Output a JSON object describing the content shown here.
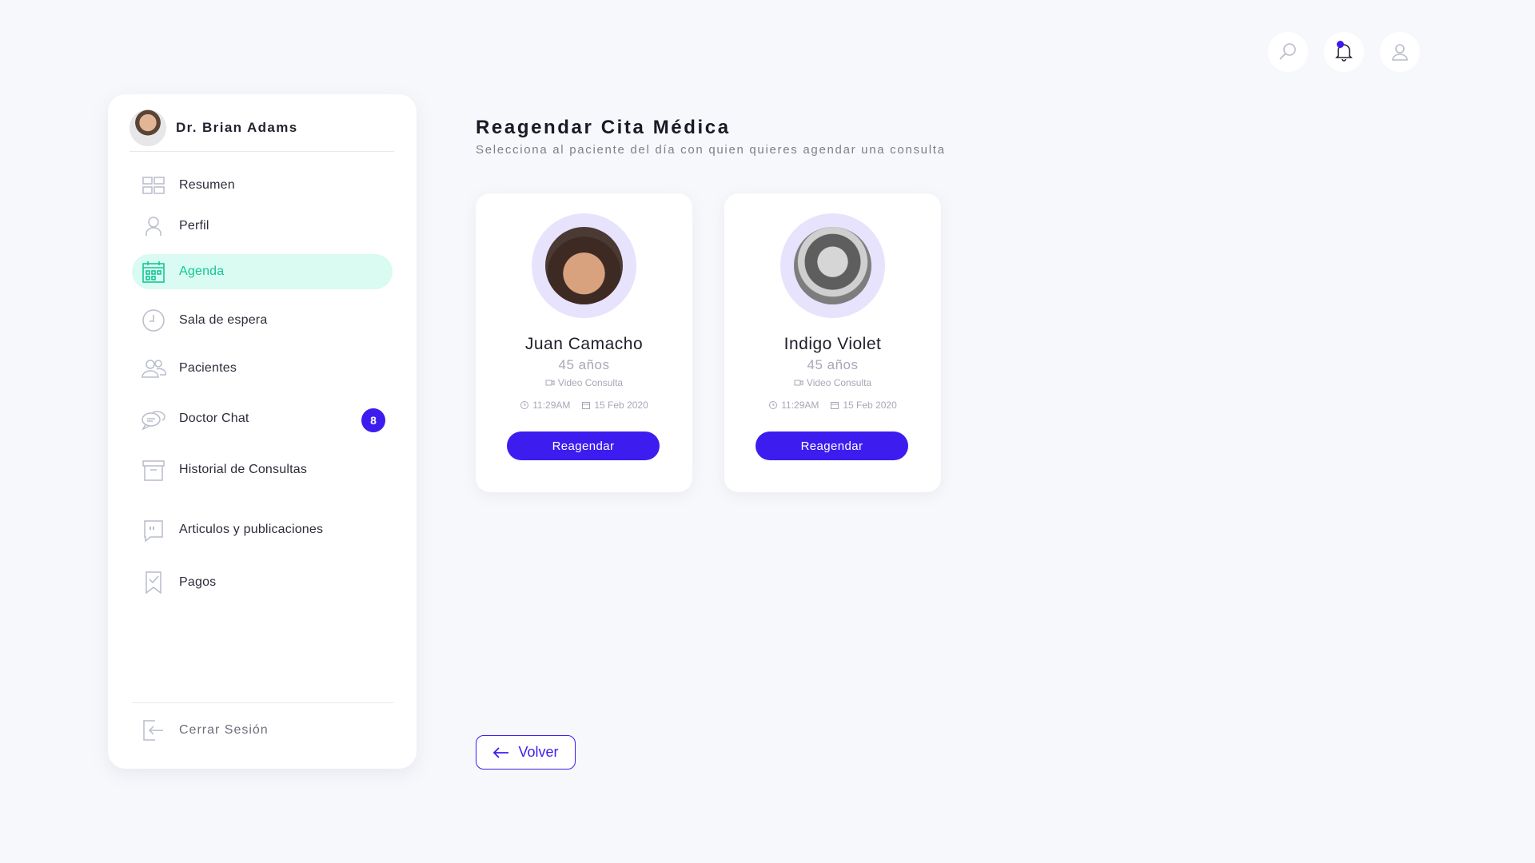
{
  "header": {
    "icons": [
      "search-icon",
      "bell-icon",
      "user-icon"
    ],
    "accent": "#3d1cf0"
  },
  "sidebar": {
    "doctor_name": "Dr. Brian Adams",
    "items": [
      {
        "label": "Resumen",
        "icon": "dashboard-grid-icon",
        "active": false
      },
      {
        "label": "Perfil",
        "icon": "user-icon",
        "active": false
      },
      {
        "label": "Agenda",
        "icon": "calendar-icon",
        "active": true
      },
      {
        "label": "Sala de espera",
        "icon": "clock-icon",
        "active": false
      },
      {
        "label": "Pacientes",
        "icon": "users-icon",
        "active": false
      },
      {
        "label": "Doctor Chat",
        "icon": "chat-icon",
        "active": false,
        "badge": "8"
      },
      {
        "label": "Historial de Consultas",
        "icon": "archive-icon",
        "active": false
      },
      {
        "label": "Articulos y publicaciones",
        "icon": "quote-icon",
        "active": false
      },
      {
        "label": "Pagos",
        "icon": "receipt-icon",
        "active": false
      }
    ],
    "logout_label": "Cerrar Sesión",
    "active_color": "#14c796",
    "active_bg": "#d9fbf1"
  },
  "main": {
    "title": "Reagendar Cita Médica",
    "subtitle": "Selecciona al paciente del día con quien quieres agendar una consulta",
    "patients": [
      {
        "name": "Juan Camacho",
        "age": "45 años",
        "type": "Video Consulta",
        "time": "11:29AM",
        "date": "15 Feb 2020",
        "button": "Reagendar"
      },
      {
        "name": "Indigo Violet",
        "age": "45 años",
        "type": "Video Consulta",
        "time": "11:29AM",
        "date": "15 Feb 2020",
        "button": "Reagendar"
      }
    ],
    "back_label": "Volver"
  }
}
